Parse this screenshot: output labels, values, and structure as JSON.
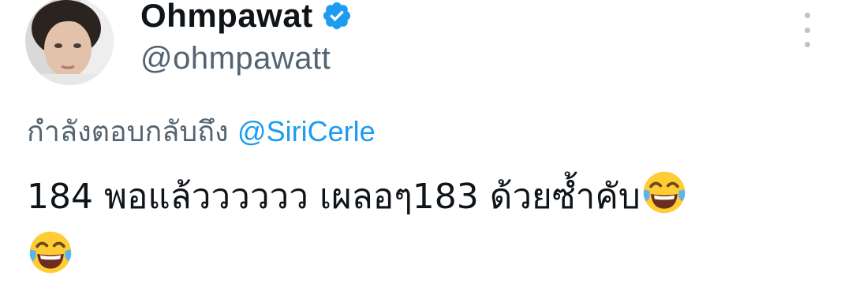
{
  "author": {
    "display_name": "Ohmpawat",
    "handle": "@ohmpawatt",
    "verified_icon": "verified-badge-icon",
    "avatar_icon": "avatar"
  },
  "menu": {
    "more_icon": "more-options-icon"
  },
  "reply": {
    "prefix": "กำลังตอบกลับถึง",
    "mention": "@SiriCerle"
  },
  "tweet": {
    "text": "184 พอแล้วววววว เผลอๆ183 ด้วยซ้ำคับ",
    "emoji": "face-with-tears-of-joy-icon"
  },
  "colors": {
    "name": "#0f1419",
    "secondary": "#536471",
    "accent": "#1d9bf0",
    "verified": "#1d9bf0"
  }
}
